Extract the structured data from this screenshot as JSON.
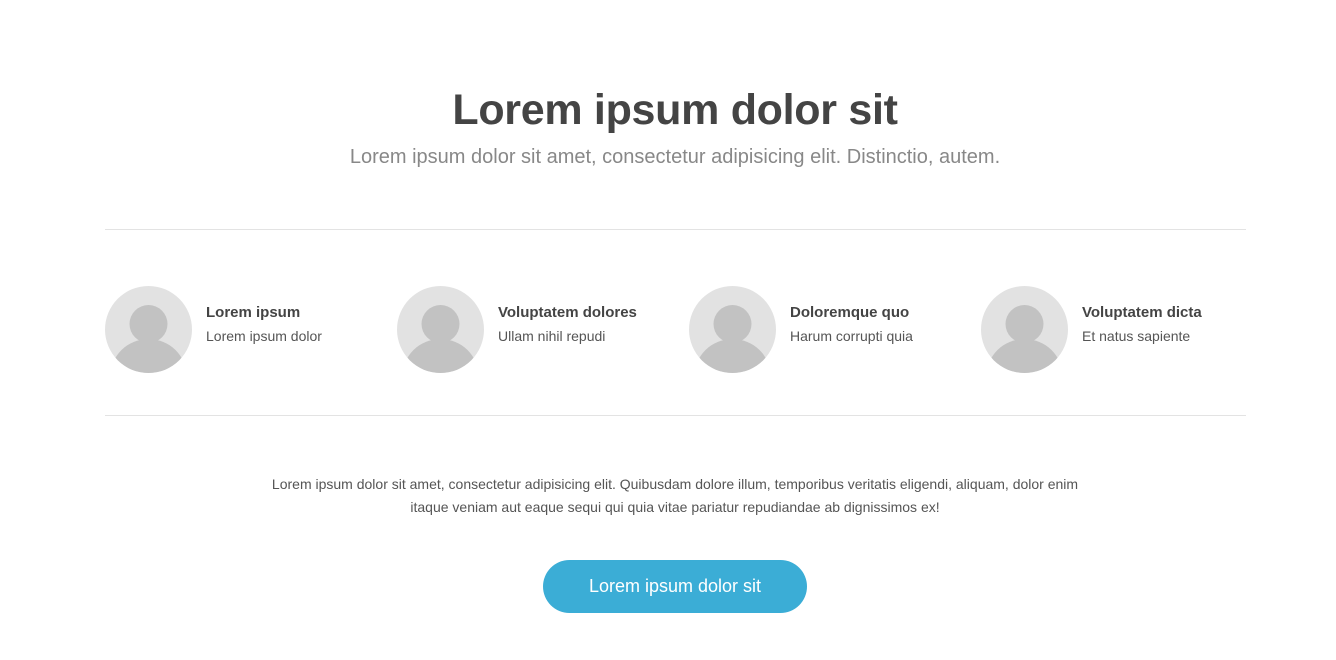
{
  "header": {
    "title": "Lorem ipsum dolor sit",
    "subtitle": "Lorem ipsum dolor sit amet, consectetur adipisicing elit. Distinctio, autem."
  },
  "team": [
    {
      "name": "Lorem ipsum",
      "role": "Lorem ipsum dolor",
      "icon": "user-avatar-icon"
    },
    {
      "name": "Voluptatem dolores",
      "role": "Ullam nihil repudi",
      "icon": "user-avatar-icon"
    },
    {
      "name": "Doloremque quo",
      "role": "Harum corrupti quia",
      "icon": "user-avatar-icon"
    },
    {
      "name": "Voluptatem dicta",
      "role": "Et natus sapiente",
      "icon": "user-avatar-icon"
    }
  ],
  "body": {
    "text": "Lorem ipsum dolor sit amet, consectetur adipisicing elit. Quibusdam dolore illum, temporibus veritatis eligendi, aliquam, dolor enim itaque veniam aut eaque sequi qui quia vitae pariatur repudiandae ab dignissimos ex!"
  },
  "cta": {
    "label": "Lorem ipsum dolor sit"
  },
  "colors": {
    "accent": "#3badd6",
    "heading": "#444444",
    "muted": "#888888",
    "avatar_bg": "#e2e2e2",
    "avatar_fg": "#c2c2c2"
  }
}
